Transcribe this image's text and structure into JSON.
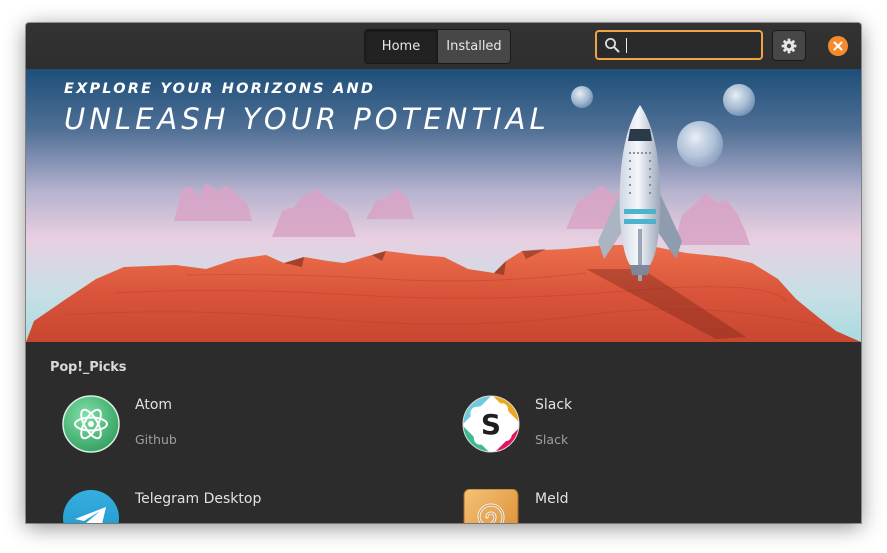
{
  "header": {
    "tabs": [
      {
        "label": "Home"
      },
      {
        "label": "Installed"
      }
    ],
    "search": {
      "value": "",
      "placeholder": ""
    },
    "accent_color": "#f2a247",
    "close_color": "#f68a2c",
    "icons": [
      "search-icon",
      "gear-icon",
      "close-icon"
    ]
  },
  "banner": {
    "tagline_top": "EXPLORE YOUR HORIZONS AND",
    "tagline_main": "UNLEASH YOUR POTENTIAL"
  },
  "picks": {
    "heading": "Pop!_Picks",
    "apps": [
      {
        "name": "Atom",
        "developer": "Github",
        "icon": "atom-app-icon"
      },
      {
        "name": "Slack",
        "developer": "Slack",
        "icon": "slack-app-icon"
      },
      {
        "name": "Telegram Desktop",
        "developer": "",
        "icon": "telegram-app-icon"
      },
      {
        "name": "Meld",
        "developer": "",
        "icon": "meld-app-icon"
      }
    ]
  }
}
